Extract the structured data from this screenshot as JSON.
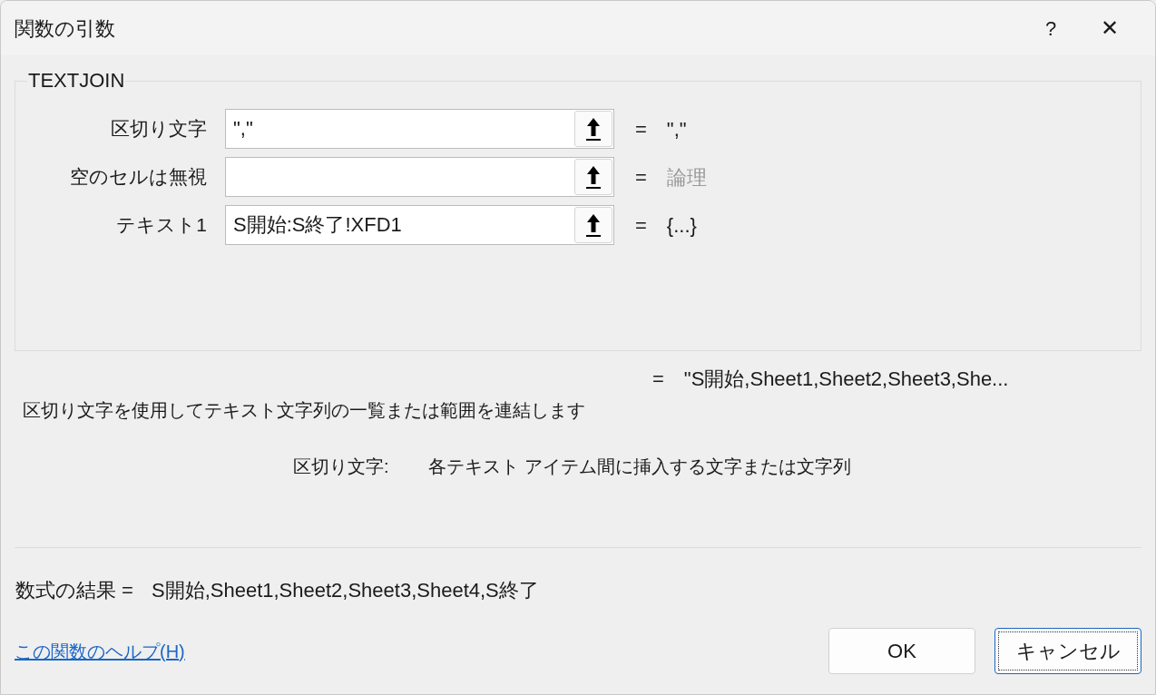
{
  "window": {
    "title": "関数の引数",
    "help_glyph": "?",
    "close_glyph": "✕"
  },
  "function_name": "TEXTJOIN",
  "arguments": [
    {
      "label": "区切り文字",
      "value": "\",\"",
      "equals": "=",
      "result": "\",\"",
      "result_is_hint": false
    },
    {
      "label": "空のセルは無視",
      "equals": "=",
      "result": "論理",
      "result_is_hint": true
    },
    {
      "label": "テキスト1",
      "value": "S開始:S終了!XFD1",
      "equals": "=",
      "result": "{...}",
      "result_is_hint": false
    }
  ],
  "function_result": {
    "equals": "=",
    "value": "\"S開始,Sheet1,Sheet2,Sheet3,She..."
  },
  "description": "区切り文字を使用してテキスト文字列の一覧または範囲を連結します",
  "argument_help": {
    "label": "区切り文字:",
    "text": "各テキスト アイテム間に挿入する文字または文字列"
  },
  "formula_result": {
    "label": "数式の結果 =",
    "value": "S開始,Sheet1,Sheet2,Sheet3,Sheet4,S終了"
  },
  "help_link": "この関数のヘルプ(H)",
  "buttons": [
    {
      "label": "OK",
      "focused": false
    },
    {
      "label": "キャンセル",
      "focused": true
    }
  ]
}
